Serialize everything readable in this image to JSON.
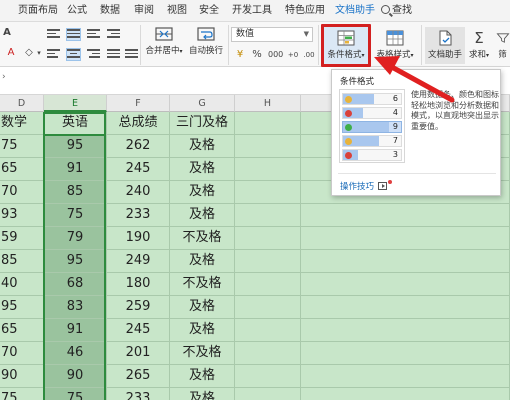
{
  "menu": {
    "items": [
      "页面布局",
      "公式",
      "数据",
      "审阅",
      "视图",
      "安全",
      "开发工具",
      "特色应用",
      "文档助手"
    ],
    "search": "查找"
  },
  "ribbon": {
    "merge_label": "合并居中",
    "wrap_label": "自动换行",
    "number_format": "数值",
    "cond_format_label": "条件格式",
    "table_style_label": "表格样式",
    "doc_helper_label": "文档助手",
    "sum_label": "求和",
    "filter_label": "筛",
    "sum_symbol": "Σ",
    "font_a": "A",
    "font_color_letter": "A"
  },
  "sheet": {
    "columns": [
      "D",
      "E",
      "F",
      "G",
      "H"
    ],
    "rows": [
      [
        "数学",
        "英语",
        "总成绩",
        "三门及格"
      ],
      [
        "75",
        "95",
        "262",
        "及格"
      ],
      [
        "65",
        "91",
        "245",
        "及格"
      ],
      [
        "70",
        "85",
        "240",
        "及格"
      ],
      [
        "93",
        "75",
        "233",
        "及格"
      ],
      [
        "59",
        "79",
        "190",
        "不及格"
      ],
      [
        "85",
        "95",
        "249",
        "及格"
      ],
      [
        "40",
        "68",
        "180",
        "不及格"
      ],
      [
        "95",
        "83",
        "259",
        "及格"
      ],
      [
        "65",
        "91",
        "245",
        "及格"
      ],
      [
        "70",
        "46",
        "201",
        "不及格"
      ],
      [
        "90",
        "90",
        "265",
        "及格"
      ],
      [
        "75",
        "75",
        "233",
        "及格"
      ]
    ]
  },
  "dropdown": {
    "title": "条件格式",
    "preview_values": [
      "6",
      "4",
      "9",
      "7",
      "3"
    ],
    "preview_dot_colors": [
      "#e8b33a",
      "#d9413a",
      "#3fae49",
      "#e8b33a",
      "#d9413a"
    ],
    "description": "使用数据条、颜色和图标轻松地浏览和分析数据和模式，以直观地突出显示重要值。",
    "tips": "操作技巧"
  },
  "colors": {
    "sheet_bg": "#c8e6c9",
    "highlight_red": "#d32020",
    "selection_green": "#2e8b3e"
  }
}
